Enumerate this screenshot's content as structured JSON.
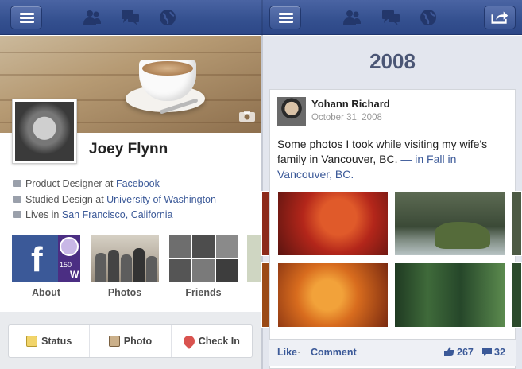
{
  "left_toolbar": {
    "icons": [
      "menu-icon",
      "friends-icon",
      "messages-icon",
      "notifications-globe-icon"
    ]
  },
  "right_toolbar": {
    "icons": [
      "menu-icon",
      "friends-icon",
      "messages-icon",
      "notifications-globe-icon",
      "share-icon"
    ]
  },
  "profile": {
    "name": "Joey Flynn",
    "work_prefix": "Product Designer at ",
    "work_link": "Facebook",
    "study_prefix": "Studied Design at ",
    "study_link": "University of Washington",
    "lives_prefix": "Lives in ",
    "lives_link": "San Francisco, California",
    "tiles": [
      {
        "label": "About"
      },
      {
        "label": "Photos"
      },
      {
        "label": "Friends"
      }
    ],
    "tile_badge": "150",
    "tile_badge_letter": "W"
  },
  "actions": {
    "status": "Status",
    "photo": "Photo",
    "checkin": "Check In"
  },
  "timeline": {
    "year": "2008",
    "post": {
      "author": "Yohann Richard",
      "date": "October 31, 2008",
      "text": "Some photos I took while visiting my wife's family in Vancouver, BC.",
      "place_suffix": " — in Fall in Vancouver, BC.",
      "like": "Like",
      "separator": " · ",
      "comment": "Comment",
      "likes_count": "267",
      "comments_count": "32"
    }
  },
  "colors": {
    "brand": "#3b5998",
    "topbar": "#3b5998",
    "timeline_bg": "#e3e6ee"
  }
}
